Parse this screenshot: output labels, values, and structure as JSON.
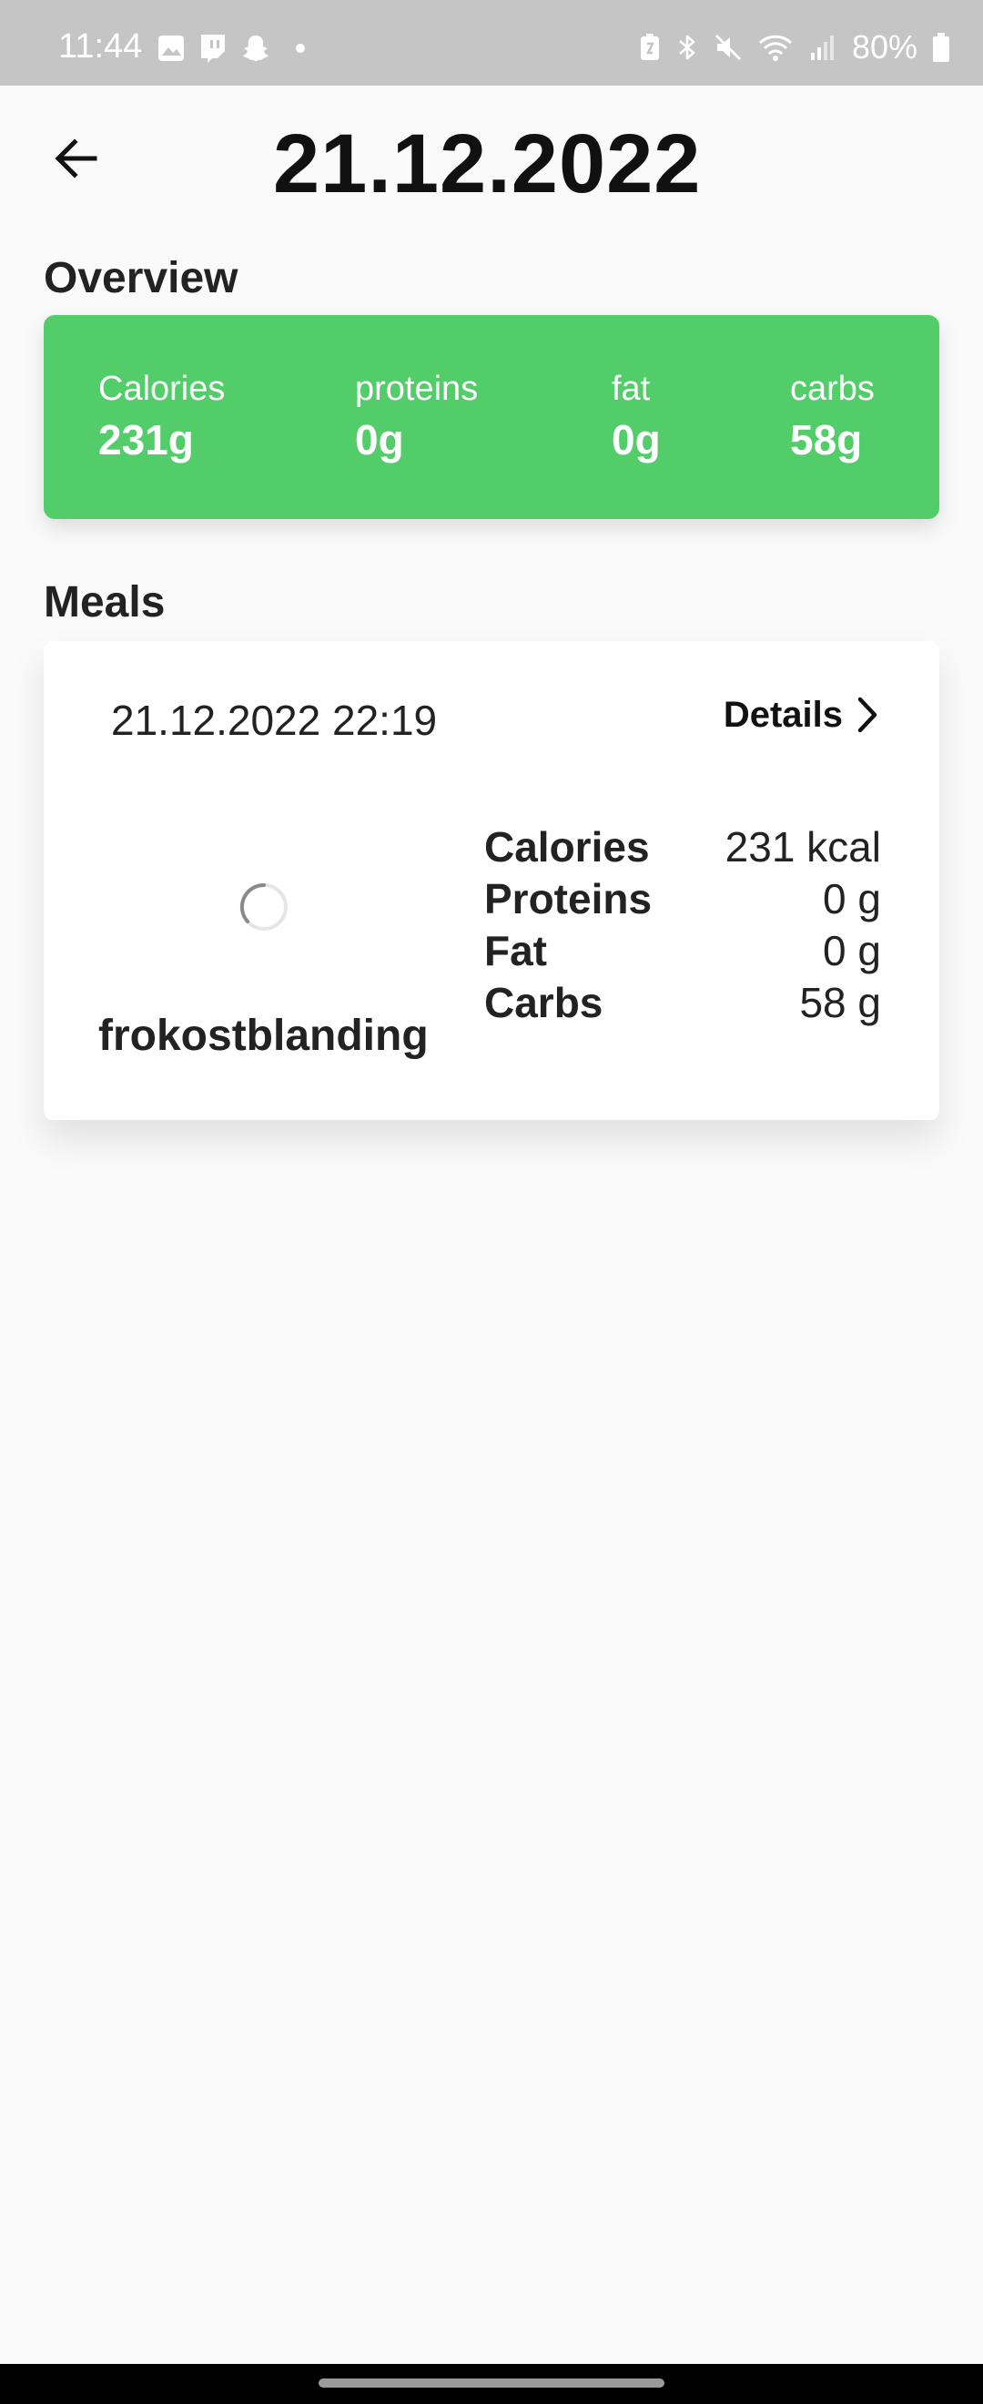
{
  "status_bar": {
    "time": "11:44",
    "battery_percent": "80%",
    "left_icons": [
      "gallery-icon",
      "twitch-icon",
      "snapchat-icon",
      "dot-icon"
    ],
    "right_icons": [
      "nfc-icon",
      "bluetooth-icon",
      "mute-icon",
      "wifi-icon",
      "signal-icon",
      "battery-icon"
    ]
  },
  "header": {
    "title": "21.12.2022",
    "back_icon": "arrow-left-icon"
  },
  "overview": {
    "section_title": "Overview",
    "accent_color": "#52cd69",
    "stats": [
      {
        "label": "Calories",
        "value": "231g"
      },
      {
        "label": "proteins",
        "value": "0g"
      },
      {
        "label": "fat",
        "value": "0g"
      },
      {
        "label": "carbs",
        "value": "58g"
      }
    ]
  },
  "meals": {
    "section_title": "Meals",
    "items": [
      {
        "datetime": "21.12.2022 22:19",
        "details_label": "Details",
        "details_icon": "chevron-right-icon",
        "name": "frokostblanding",
        "image_state": "loading",
        "nutrients": [
          {
            "name": "Calories",
            "value": "231 kcal"
          },
          {
            "name": "Proteins",
            "value": "0 g"
          },
          {
            "name": "Fat",
            "value": "0 g"
          },
          {
            "name": "Carbs",
            "value": "58 g"
          }
        ]
      }
    ]
  }
}
